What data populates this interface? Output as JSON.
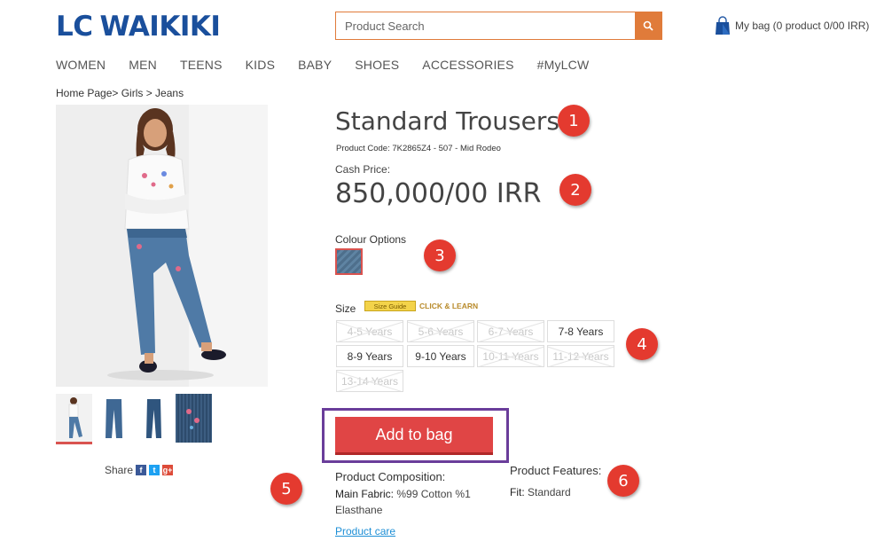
{
  "brand": {
    "logo_part1": "LC",
    "logo_part2": "WAIKIKI",
    "color": "#1a4f9c"
  },
  "search": {
    "placeholder": "Product Search",
    "icon": "search-icon",
    "accent": "#e07b3a"
  },
  "bag": {
    "label": "My bag (0 product 0/00 IRR)",
    "icon": "shopping-bag-icon"
  },
  "nav": [
    "WOMEN",
    "MEN",
    "TEENS",
    "KIDS",
    "BABY",
    "SHOES",
    "ACCESSORIES",
    "#MyLCW"
  ],
  "breadcrumb": "Home Page> Girls > Jeans",
  "product": {
    "title": "Standard Trousers",
    "code": "Product Code: 7K2865Z4 - 507 - Mid Rodeo",
    "cash_label": "Cash Price:",
    "price": "850,000/00 IRR",
    "colour_label": "Colour Options",
    "size_label": "Size",
    "size_guide": "Size Guide",
    "click_learn": "CLICK & LEARN",
    "sizes": [
      {
        "label": "4-5 Years",
        "available": false
      },
      {
        "label": "5-6 Years",
        "available": false
      },
      {
        "label": "6-7 Years",
        "available": false
      },
      {
        "label": "7-8 Years",
        "available": true
      },
      {
        "label": "8-9 Years",
        "available": true
      },
      {
        "label": "9-10 Years",
        "available": true
      },
      {
        "label": "10-11 Years",
        "available": false
      },
      {
        "label": "11-12 Years",
        "available": false
      },
      {
        "label": "13-14 Years",
        "available": false
      }
    ],
    "add_to_bag": "Add to bag",
    "composition_title": "Product Composition:",
    "composition_key": "Main Fabric:",
    "composition_value": "%99 Cotton %1 Elasthane",
    "care_link": "Product care",
    "features_title": "Product Features:",
    "feature_key": "Fit:",
    "feature_value": "Standard"
  },
  "share": {
    "label": "Share",
    "networks": [
      "f",
      "t",
      "g+"
    ],
    "colors": [
      "#3b5998",
      "#1da1f2",
      "#dd4b39"
    ]
  },
  "markers": [
    "1",
    "2",
    "3",
    "4",
    "5",
    "6"
  ],
  "colors": {
    "accent_red": "#e04545",
    "highlight_purple": "#6a3d9a",
    "marker_red": "#e43a2f",
    "link_blue": "#1e8fd6"
  }
}
